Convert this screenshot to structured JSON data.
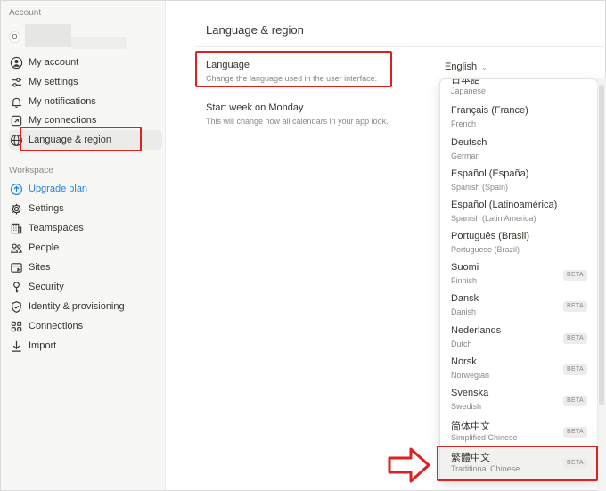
{
  "sidebar": {
    "account_label": "Account",
    "avatar_initial": "O",
    "account_items": [
      {
        "label": "My account",
        "icon": "user-circle-icon"
      },
      {
        "label": "My settings",
        "icon": "sliders-icon"
      },
      {
        "label": "My notifications",
        "icon": "bell-icon"
      },
      {
        "label": "My connections",
        "icon": "external-link-icon"
      },
      {
        "label": "Language & region",
        "icon": "globe-icon",
        "active": true
      }
    ],
    "workspace_label": "Workspace",
    "workspace_items": [
      {
        "label": "Upgrade plan",
        "icon": "arrow-up-circle-icon",
        "accent": true
      },
      {
        "label": "Settings",
        "icon": "gear-icon"
      },
      {
        "label": "Teamspaces",
        "icon": "building-icon"
      },
      {
        "label": "People",
        "icon": "people-icon"
      },
      {
        "label": "Sites",
        "icon": "browser-icon"
      },
      {
        "label": "Security",
        "icon": "key-icon"
      },
      {
        "label": "Identity & provisioning",
        "icon": "shield-check-icon"
      },
      {
        "label": "Connections",
        "icon": "grid-icon"
      },
      {
        "label": "Import",
        "icon": "download-icon"
      }
    ]
  },
  "main": {
    "title": "Language & region",
    "language": {
      "label": "Language",
      "description": "Change the language used in the user interface.",
      "selected": "English"
    },
    "week": {
      "label": "Start week on Monday",
      "description": "This will change how all calendars in your app look."
    }
  },
  "dropdown": {
    "beta_label": "BETA",
    "options": [
      {
        "name": "日本語",
        "sub": "Japanese",
        "beta": false
      },
      {
        "name": "Français (France)",
        "sub": "French",
        "beta": false
      },
      {
        "name": "Deutsch",
        "sub": "German",
        "beta": false
      },
      {
        "name": "Español (España)",
        "sub": "Spanish (Spain)",
        "beta": false
      },
      {
        "name": "Español (Latinoamérica)",
        "sub": "Spanish (Latin America)",
        "beta": false
      },
      {
        "name": "Português (Brasil)",
        "sub": "Portuguese (Brazil)",
        "beta": false
      },
      {
        "name": "Suomi",
        "sub": "Finnish",
        "beta": true
      },
      {
        "name": "Dansk",
        "sub": "Danish",
        "beta": true
      },
      {
        "name": "Nederlands",
        "sub": "Dutch",
        "beta": true
      },
      {
        "name": "Norsk",
        "sub": "Norwegian",
        "beta": true
      },
      {
        "name": "Svenska",
        "sub": "Swedish",
        "beta": true
      },
      {
        "name": "简体中文",
        "sub": "Simplified Chinese",
        "beta": true
      },
      {
        "name": "繁體中文",
        "sub": "Traditional Chinese",
        "beta": true,
        "highlighted": true
      }
    ]
  },
  "colors": {
    "annotation_red": "#e02020",
    "accent_blue": "#2383e2"
  }
}
